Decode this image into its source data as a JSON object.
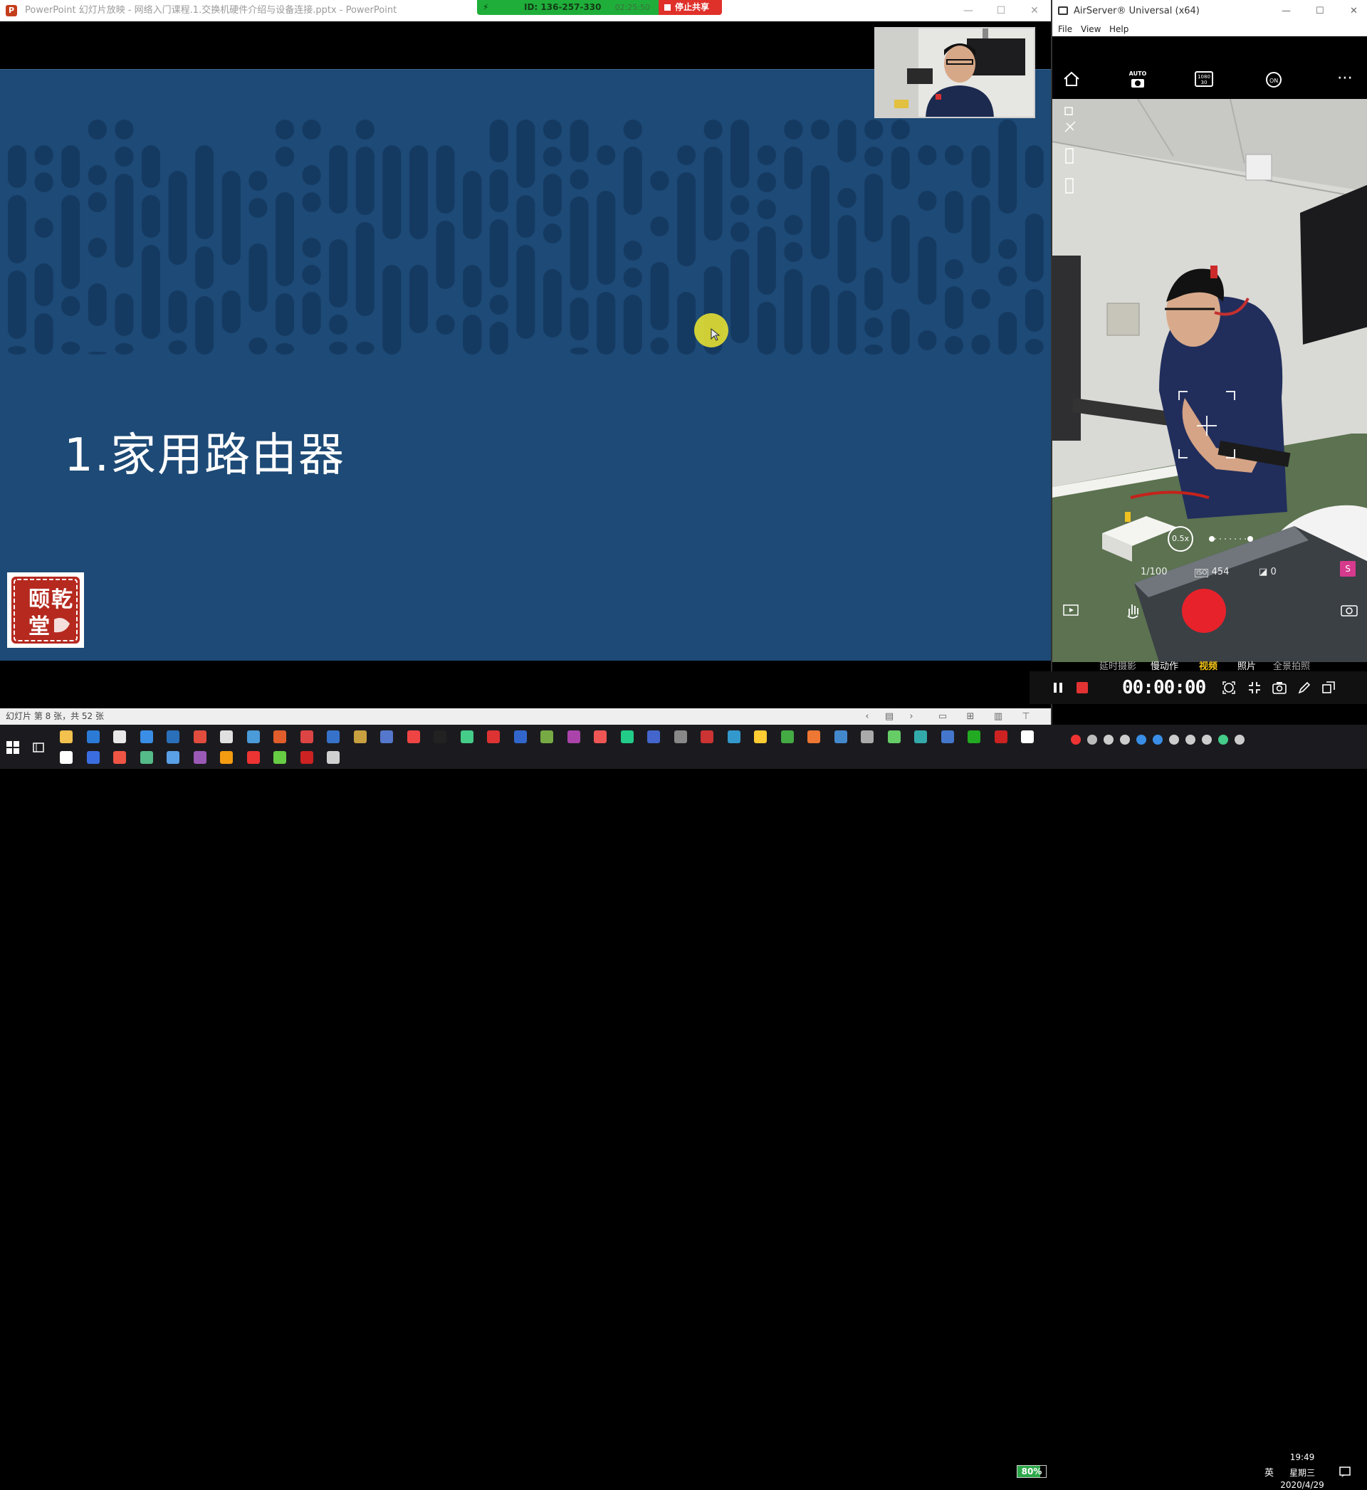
{
  "ppt": {
    "window_title": "PowerPoint 幻灯片放映  -  网络入门课程.1.交换机硬件介绍与设备连接.pptx - PowerPoint",
    "logo_letter": "P",
    "slide_heading": "1.家用路由器",
    "slide_bg": "#1d4a76",
    "pattern_color": "#153a62",
    "status_text": "幻灯片 第 8 张，共 52 张",
    "seal_text": "颐乾堂"
  },
  "share_bar": {
    "id_text": "ID: 136-257-330",
    "elapsed": "02:25:50",
    "stop_label": "停止共享"
  },
  "airserver": {
    "window_title": "AirServer® Universal (x64)",
    "menu": [
      "File",
      "View",
      "Help"
    ],
    "auto_label": "AUTO",
    "res_label": "1080 30",
    "camera": {
      "zoom": "0.5x",
      "shutter": "1/100",
      "iso_label": "ISO",
      "iso": "454",
      "ev": "0",
      "side_badge": "S",
      "modes": [
        "延时摄影",
        "慢动作",
        "视频",
        "照片",
        "全景拍照"
      ],
      "active_mode": "视频",
      "recording_time": "00:00:00"
    }
  },
  "taskbar": {
    "battery_percent": "80%",
    "battery_level": 0.8,
    "ime": "英",
    "time": "19:49",
    "weekday": "星期三",
    "date": "2020/4/29"
  }
}
